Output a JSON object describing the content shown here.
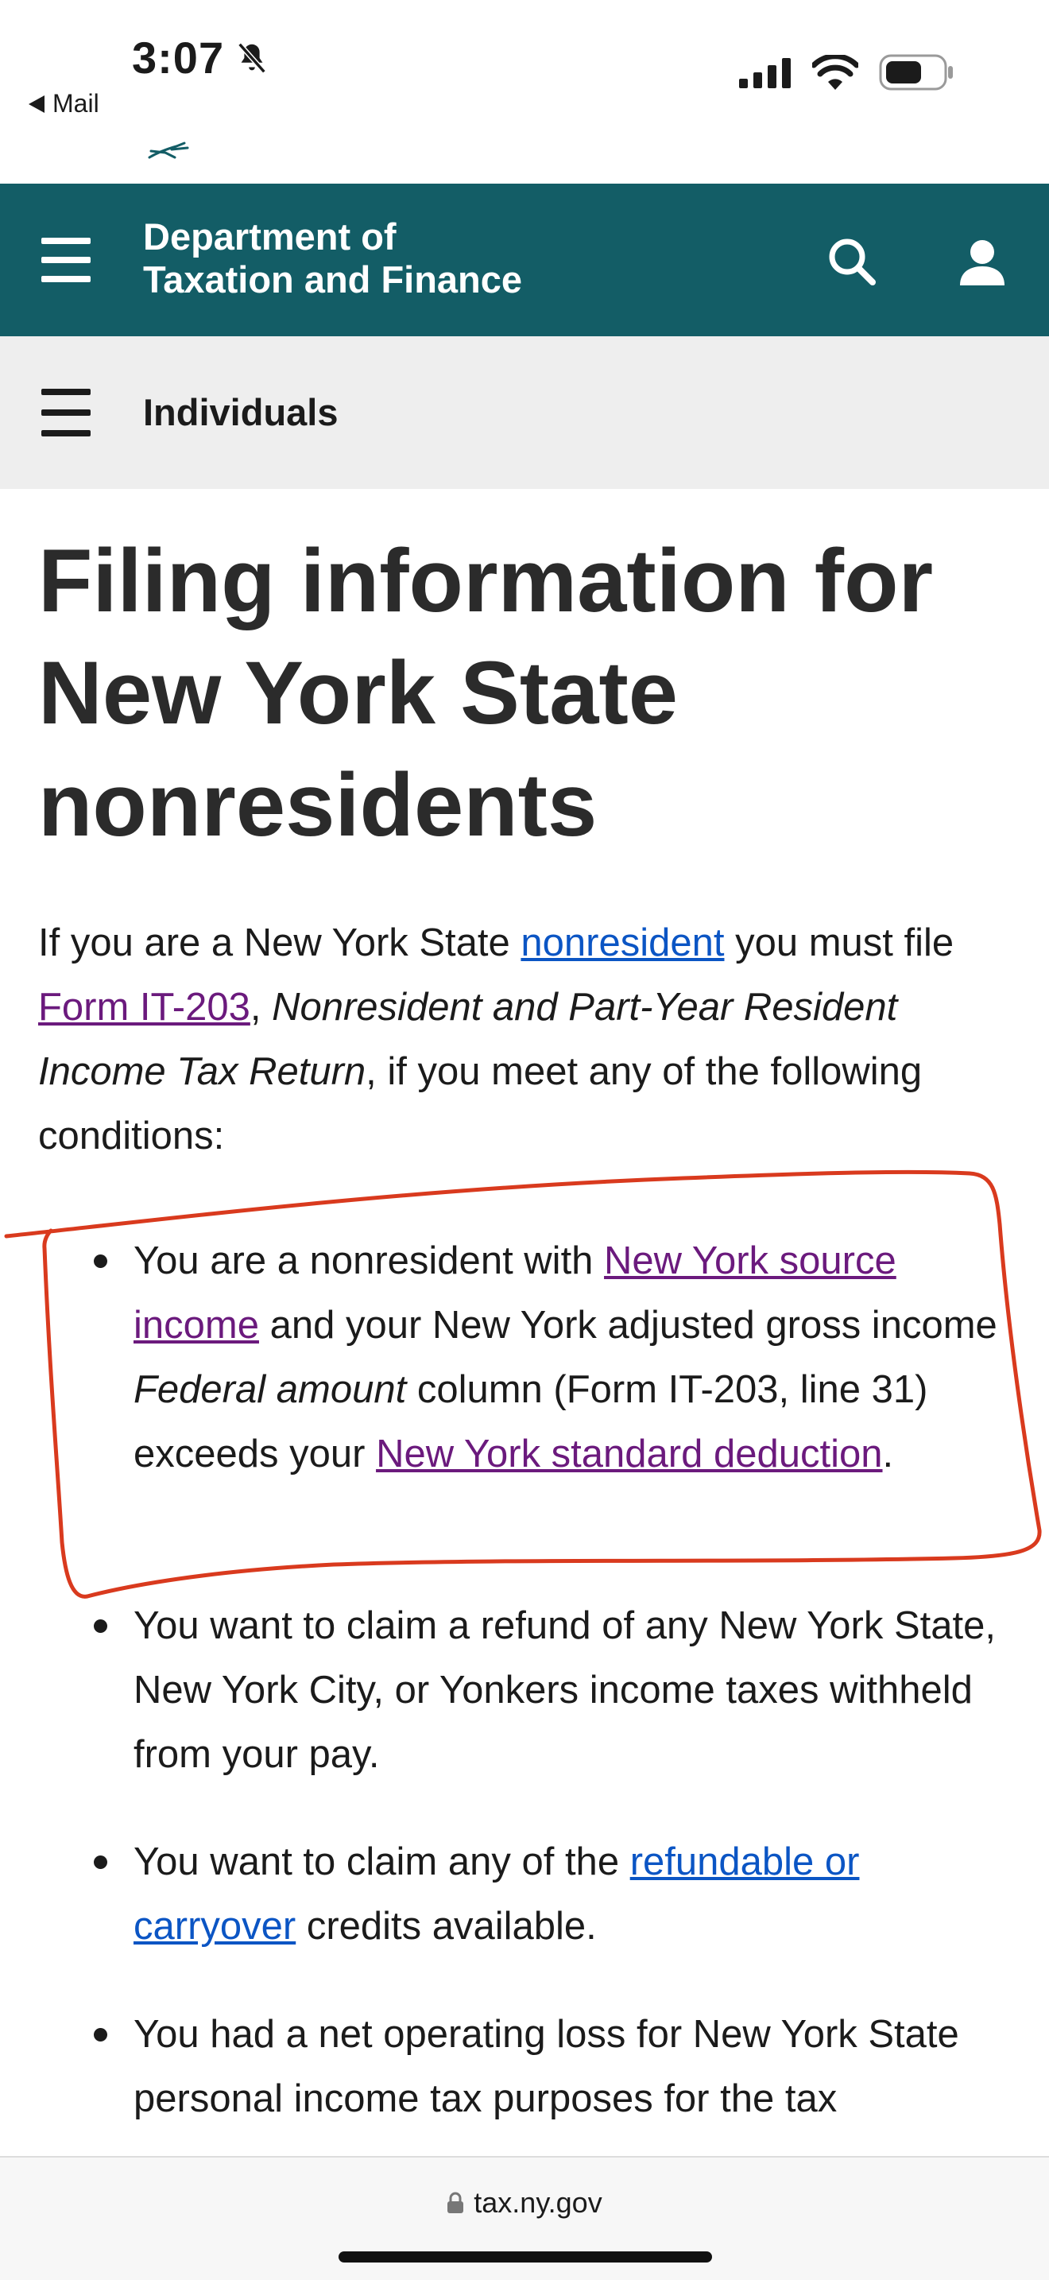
{
  "status_bar": {
    "time": "3:07",
    "back_label": "Mail"
  },
  "header": {
    "agency_line1": "Department of",
    "agency_line2": "Taxation and Finance",
    "brand_color": "#135d66"
  },
  "section_nav": {
    "title": "Individuals"
  },
  "main": {
    "page_title": "Filing information for New York State nonresidents",
    "intro": {
      "part1": "If you are a New York State ",
      "link_nonresident": "nonresident",
      "part2": " you must file ",
      "link_form": "Form IT-203",
      "part3": ", ",
      "form_title": "Nonresident and Part-Year Resident Income Tax Return",
      "part4": ", if you meet any of the following conditions:"
    },
    "conditions": [
      {
        "part1": "You are a nonresident with ",
        "link1": "New York source income",
        "part2": " and your New York adjusted gross income ",
        "italic": "Federal amount",
        "part3": " column (Form IT-203, line 31) exceeds your ",
        "link2": "New York standard deduction",
        "part4": "."
      },
      {
        "text": "You want to claim a refund of any New York State, New York City, or Yonkers income taxes withheld from your pay."
      },
      {
        "part1": "You want to claim any of the ",
        "link": "refundable or carryover",
        "part2": " credits available."
      },
      {
        "text": "You had a net operating loss for New York State personal income tax purposes for the tax"
      }
    ]
  },
  "browser": {
    "url": "tax.ny.gov"
  },
  "colors": {
    "link": "#0b55c4",
    "visited_link": "#6b1a7d",
    "annotation": "#d93a1e"
  }
}
